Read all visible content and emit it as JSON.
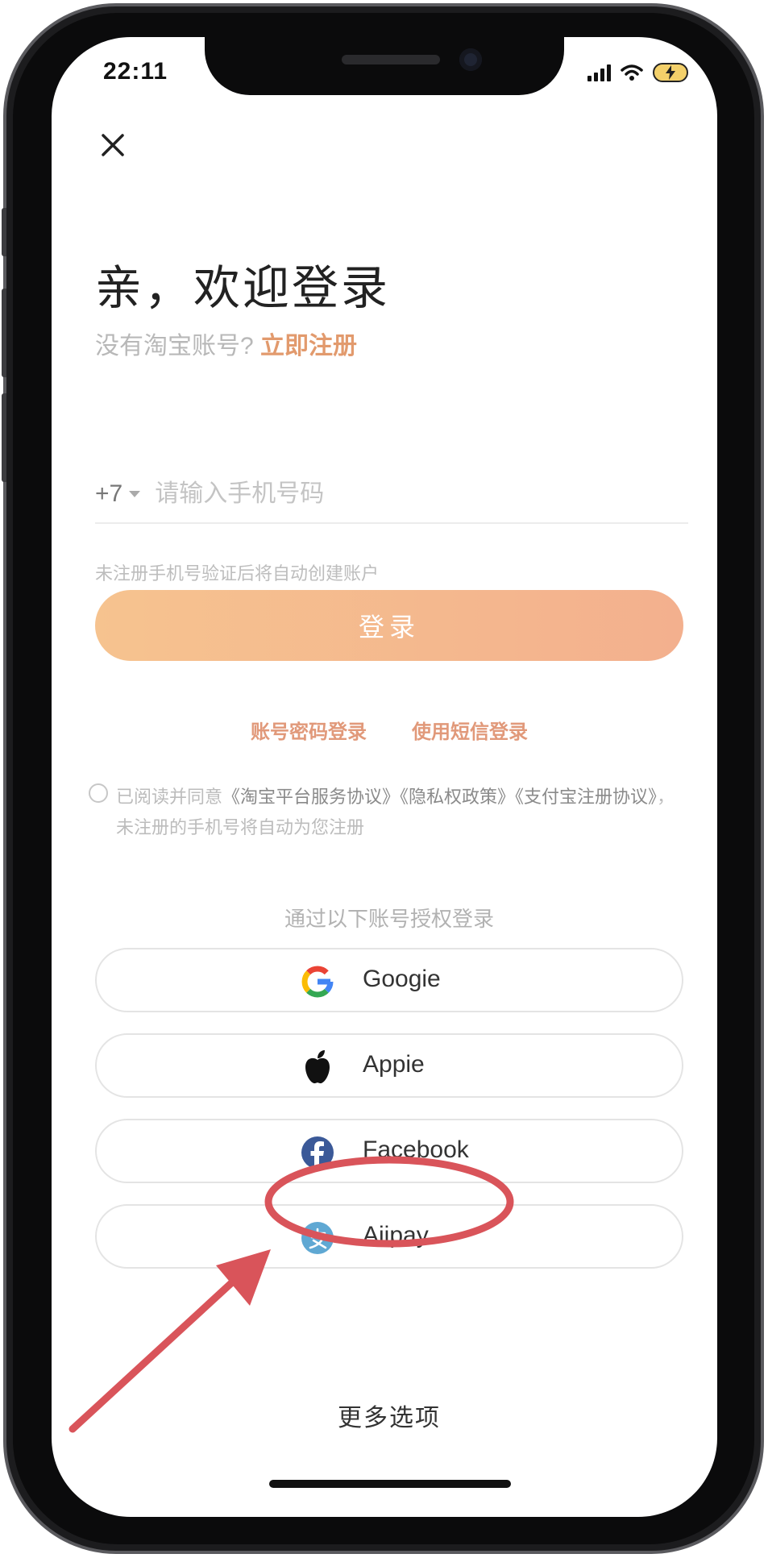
{
  "status_bar": {
    "time": "22:11",
    "icons": [
      "cellular-signal-icon",
      "wifi-icon",
      "battery-charging-icon"
    ]
  },
  "header": {
    "close_icon": "close-icon",
    "title": "亲，欢迎登录",
    "subtitle_prefix": "没有淘宝账号?",
    "register_label": "立即注册"
  },
  "phone_login": {
    "country_code": "+7",
    "placeholder": "请输入手机号码",
    "value": "",
    "hint": "未注册手机号验证后将自动创建账户",
    "login_label": "登录"
  },
  "alt_login": {
    "password_label": "账号密码登录",
    "sms_label": "使用短信登录"
  },
  "agreement": {
    "prefix": "已阅读并同意",
    "doc1": "《淘宝平台服务协议》",
    "doc2": "《隐私权政策》",
    "doc3": "《支付宝注册协议》",
    "rest": "，未注册的手机号将自动为您注册"
  },
  "oauth": {
    "heading": "通过以下账号授权登录",
    "providers": [
      {
        "label": "Googie",
        "icon": "google-icon"
      },
      {
        "label": "Appie",
        "icon": "apple-icon"
      },
      {
        "label": "Facebook",
        "icon": "facebook-icon"
      },
      {
        "label": "Aiipay",
        "icon": "alipay-icon"
      }
    ]
  },
  "footer": {
    "more_options_label": "更多选项"
  },
  "colors": {
    "accent": "#e29a6d",
    "login_gradient_start": "#f6c38f",
    "login_gradient_end": "#f3b08e",
    "annotation": "#d9545a",
    "facebook": "#3b5998",
    "alipay": "#5fa8d3"
  }
}
